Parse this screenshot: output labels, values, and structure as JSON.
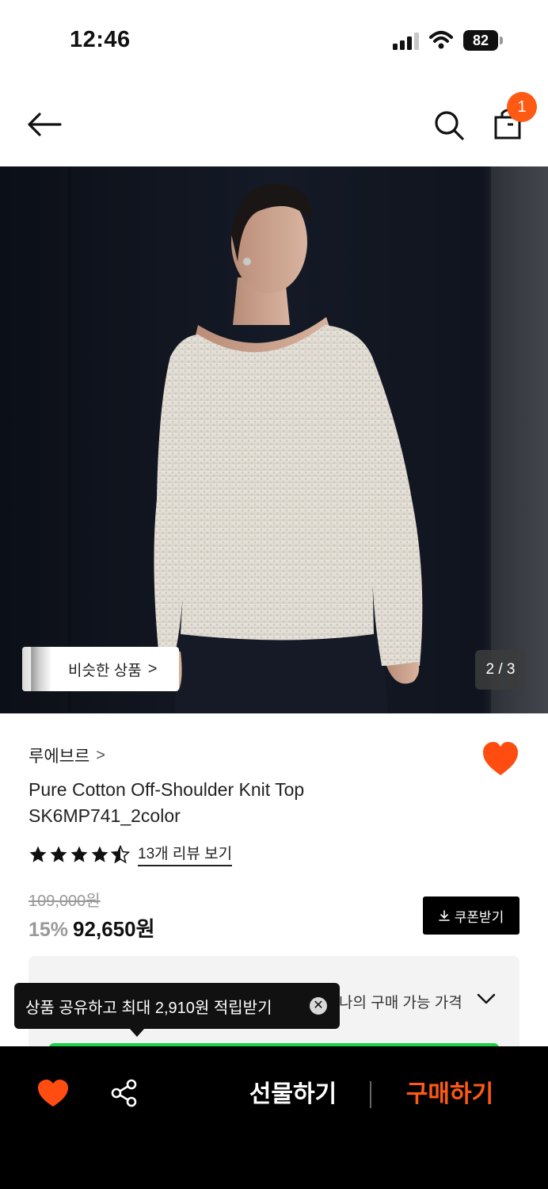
{
  "status_bar": {
    "time": "12:46",
    "battery_level": "82",
    "icons": [
      "signal-icon",
      "wifi-icon",
      "battery-icon"
    ]
  },
  "header": {
    "icons": [
      "back-arrow-icon",
      "search-icon",
      "shopping-bag-icon"
    ],
    "cart_count": "1"
  },
  "hero": {
    "similar_products_label": "비슷한 상품",
    "similar_products_chevron": ">",
    "page_indicator": "2 / 3"
  },
  "product": {
    "brand": "루에브르",
    "brand_chevron": ">",
    "title_line1": "Pure Cotton Off-Shoulder Knit Top",
    "title_line2": "SK6MP741_2color",
    "rating": 4.5,
    "rating_max": 5,
    "review_link": "13개 리뷰 보기",
    "wishlisted": true
  },
  "price": {
    "original_price": "109,000원",
    "discount_rate": "15%",
    "sale_price": "92,650원",
    "coupon_button": "쿠폰받기"
  },
  "best_price_box": {
    "my_price_label": "나의 구매 가능 가격"
  },
  "share_tooltip": {
    "text": "상품 공유하고 최대 2,910원 적립받기",
    "close_symbol": "✕"
  },
  "bottom_bar": {
    "gift_button": "선물하기",
    "buy_button": "구매하기"
  },
  "colors": {
    "accent_orange": "#ff5a14",
    "badge_orange": "#ff5a14",
    "heart_red_orange": "#ff4d12",
    "highlight_green": "#1fd14a",
    "bottom_bar_bg": "#000000"
  }
}
